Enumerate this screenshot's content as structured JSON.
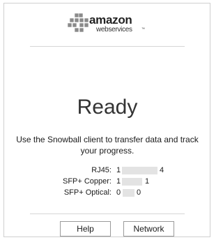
{
  "logo": {
    "word": "amazon",
    "sub": "webservices",
    "tm": "™"
  },
  "status": {
    "title": "Ready",
    "message": "Use the Snowball client to transfer data and track your progress."
  },
  "ports": [
    {
      "label": "RJ45:",
      "start": "1",
      "end": "4"
    },
    {
      "label": "SFP+ Copper:",
      "start": "1",
      "end": "1"
    },
    {
      "label": "SFP+ Optical:",
      "start": "0",
      "end": "0"
    }
  ],
  "buttons": {
    "help": "Help",
    "network": "Network"
  }
}
